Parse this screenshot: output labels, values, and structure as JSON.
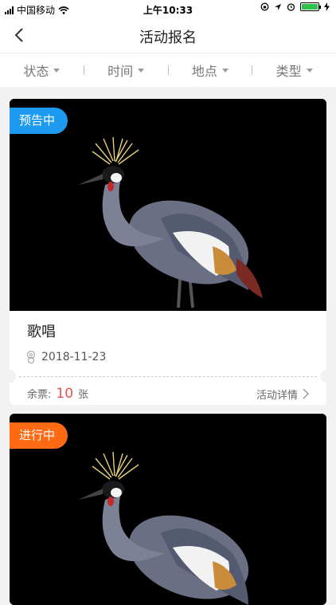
{
  "status_bar": {
    "carrier": "中国移动",
    "time": "上午10:33",
    "battery_level": 1.0
  },
  "nav": {
    "title": "活动报名"
  },
  "filters": [
    {
      "label": "状态"
    },
    {
      "label": "时间"
    },
    {
      "label": "地点"
    },
    {
      "label": "类型"
    }
  ],
  "events": [
    {
      "status": "预告中",
      "status_color": "#1c9bf0",
      "title": "歌唱",
      "date": "2018-11-23",
      "tickets_label": "余票:",
      "tickets_count": "10",
      "tickets_unit": "张",
      "detail_label": "活动详情"
    },
    {
      "status": "进行中",
      "status_color": "#ff6a12"
    }
  ],
  "icons": {
    "back": "chevron-left-icon",
    "location": "location-icon",
    "detail": "chevron-right-icon"
  }
}
